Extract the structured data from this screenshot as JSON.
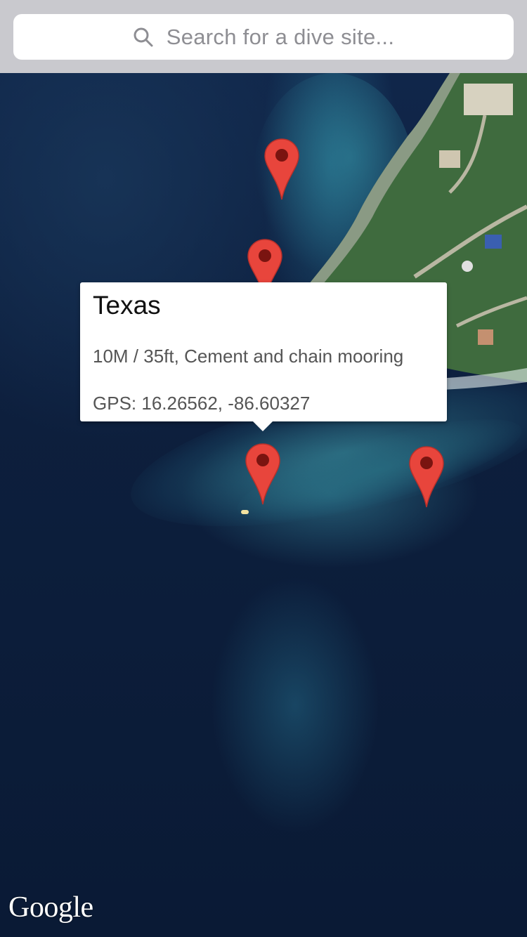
{
  "search": {
    "placeholder": "Search for a dive site..."
  },
  "map": {
    "type": "satellite",
    "attribution": "Google",
    "markers": [
      {
        "name": "marker-1"
      },
      {
        "name": "marker-2"
      },
      {
        "name": "marker-texas",
        "selected": true
      },
      {
        "name": "marker-4"
      }
    ],
    "marker_color": "#e8453c"
  },
  "info_window": {
    "title": "Texas",
    "details": "10M / 35ft, Cement and chain mooring",
    "gps": "GPS: 16.26562, -86.60327"
  }
}
